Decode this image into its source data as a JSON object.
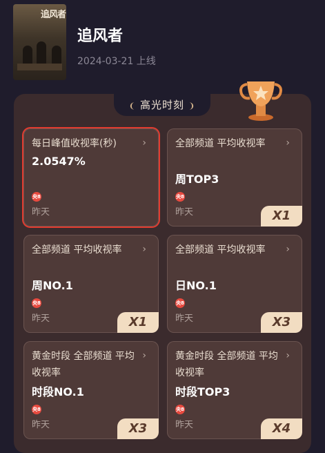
{
  "show": {
    "title": "追风者",
    "date": "2024-03-21 上线",
    "poster_title": "追风者"
  },
  "section": {
    "title": "高光时刻"
  },
  "cards": [
    {
      "name": "每日峰值收视率(秒)",
      "value": "2.0547%",
      "channel": "央8",
      "when": "昨天",
      "badge": ""
    },
    {
      "name": "全部频道 平均收视率",
      "value": "周TOP3",
      "channel": "央8",
      "when": "昨天",
      "badge": "X1"
    },
    {
      "name": "全部频道 平均收视率",
      "value": "周NO.1",
      "channel": "央8",
      "when": "昨天",
      "badge": "X1"
    },
    {
      "name": "全部频道 平均收视率",
      "value": "日NO.1",
      "channel": "央8",
      "when": "昨天",
      "badge": "X3"
    },
    {
      "name": "黄金时段 全部频道 平均收视率",
      "value": "时段NO.1",
      "channel": "央8",
      "when": "昨天",
      "badge": "X3"
    },
    {
      "name": "黄金时段 全部频道 平均收视率",
      "value": "时段TOP3",
      "channel": "央8",
      "when": "昨天",
      "badge": "X4"
    }
  ],
  "colors": {
    "background": "#1f1c2c",
    "panel": "#3b2b2d",
    "card": "#4f3a38",
    "highlight_border": "#e33b2f",
    "badge": "#f2ddc2"
  },
  "icons": {
    "arrow": "chevron-right-icon",
    "channel": "cctv8-logo-icon",
    "trophy": "trophy-icon",
    "laurel": "laurel-icon"
  }
}
